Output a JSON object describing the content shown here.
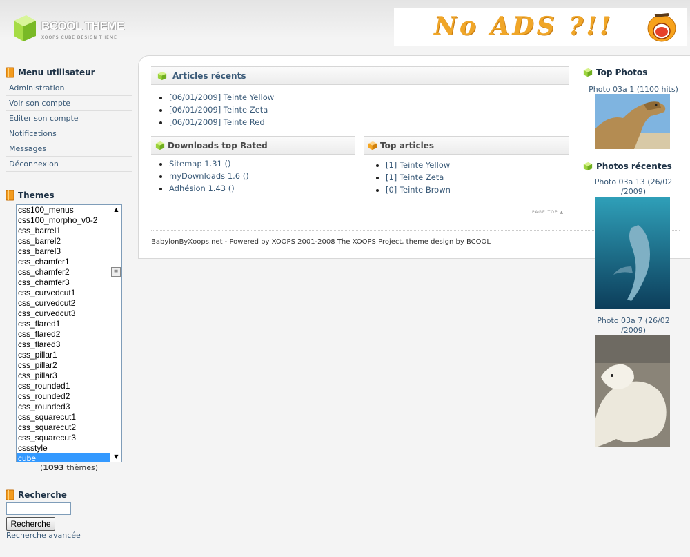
{
  "header": {
    "logo_name": "BCOOL THEME",
    "logo_tagline": "XOOPS CUBE DESIGN THEME",
    "banner_text": "No ADS ?!!"
  },
  "user_menu": {
    "title": "Menu utilisateur",
    "items": [
      "Administration",
      "Voir son compte",
      "Editer son compte",
      "Notifications",
      "Messages",
      "Déconnexion"
    ]
  },
  "themes": {
    "title": "Themes",
    "options": [
      "css100_menus",
      "css100_morpho_v0-2",
      "css_barrel1",
      "css_barrel2",
      "css_barrel3",
      "css_chamfer1",
      "css_chamfer2",
      "css_chamfer3",
      "css_curvedcut1",
      "css_curvedcut2",
      "css_curvedcut3",
      "css_flared1",
      "css_flared2",
      "css_flared3",
      "css_pillar1",
      "css_pillar2",
      "css_pillar3",
      "css_rounded1",
      "css_rounded2",
      "css_rounded3",
      "css_squarecut1",
      "css_squarecut2",
      "css_squarecut3",
      "cssstyle",
      "cube"
    ],
    "selected": "cube",
    "count_number": "1093",
    "count_suffix": "thèmes"
  },
  "search": {
    "title": "Recherche",
    "value": "",
    "button_label": "Recherche",
    "advanced_label": "Recherche avancée"
  },
  "recent_articles": {
    "title": "Articles récents",
    "items": [
      "[06/01/2009] Teinte Yellow",
      "[06/01/2009] Teinte Zeta",
      "[06/01/2009] Teinte Red"
    ]
  },
  "downloads_top": {
    "title": "Downloads top Rated",
    "items": [
      "Sitemap 1.31 ()",
      "myDownloads 1.6 ()",
      "Adhésion 1.43 ()"
    ]
  },
  "top_articles": {
    "title": "Top articles",
    "items": [
      "[1] Teinte Yellow",
      "[1] Teinte Zeta",
      "[0] Teinte Brown"
    ]
  },
  "page_top": "PAGE TOP",
  "footer": "BabylonByXoops.net - Powered by XOOPS 2001-2008 The XOOPS Project, theme design by BCOOL",
  "top_photos": {
    "title": "Top Photos",
    "caption": "Photo 03a 1 (1100 hits)"
  },
  "recent_photos": {
    "title": "Photos récentes",
    "items": [
      {
        "caption_line1": "Photo 03a 13 (26/02",
        "caption_line2": "/2009)"
      },
      {
        "caption_line1": "Photo 03a 7 (26/02",
        "caption_line2": "/2009)"
      }
    ]
  },
  "colors": {
    "link": "#3a5a78",
    "block_title": "#1e3246",
    "selected_option": "#3399ff",
    "icon_green": "#9bd33c",
    "icon_orange": "#f5a623"
  }
}
